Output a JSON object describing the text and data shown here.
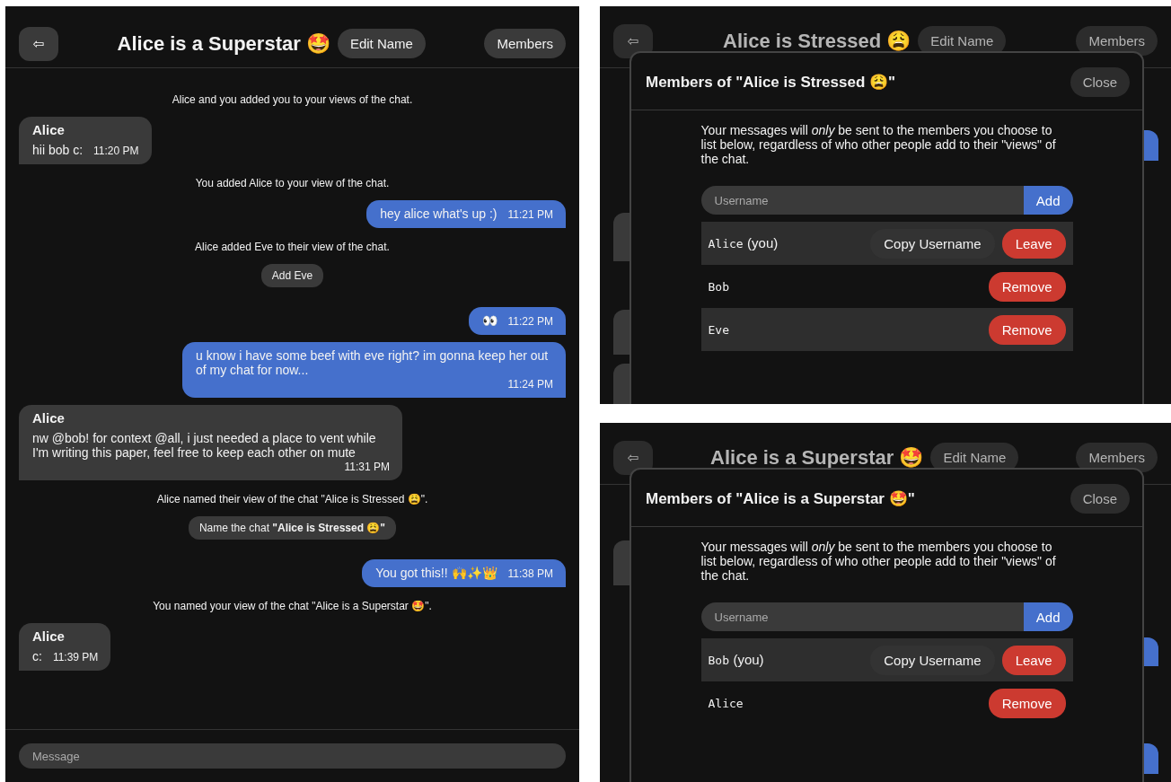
{
  "panels": [
    {
      "header": {
        "back_button": "⇦",
        "title": "Alice is a Superstar 🤩",
        "edit_button": "Edit Name",
        "members_button": "Members"
      },
      "messages": [
        {
          "kind": "system",
          "text": "Alice and you added you to your views of the chat."
        },
        {
          "kind": "incoming",
          "sender": "Alice",
          "text": "hii bob c:",
          "time": "11:20 PM"
        },
        {
          "kind": "system",
          "text": "You added Alice to your view of the chat."
        },
        {
          "kind": "outgoing",
          "text": "hey alice what's up :)",
          "time": "11:21 PM"
        },
        {
          "kind": "system",
          "text": "Alice added Eve to their view of the chat."
        },
        {
          "kind": "action",
          "text": "Add Eve"
        },
        {
          "kind": "outgoing",
          "text": "👀",
          "time": "11:22 PM"
        },
        {
          "kind": "outgoing",
          "text": "u know i have some beef with eve right? im gonna keep her out of my chat for now...",
          "time": "11:24 PM"
        },
        {
          "kind": "incoming",
          "sender": "Alice",
          "text": "nw @bob! for context @all, i just needed a place to vent while I'm writing this paper, feel free to keep each other on mute",
          "time": "11:31 PM"
        },
        {
          "kind": "system",
          "text": "Alice named their view of the chat \"Alice is Stressed 😩\"."
        },
        {
          "kind": "action",
          "text": "Name the chat **\"Alice is Stressed 😩\"**"
        },
        {
          "kind": "outgoing",
          "text": "You got this!! 🙌✨👑",
          "time": "11:38 PM"
        },
        {
          "kind": "system",
          "text": "You named your view of the chat \"Alice is a Superstar 🤩\"."
        },
        {
          "kind": "incoming",
          "sender": "Alice",
          "text": "c:",
          "time": "11:39 PM"
        }
      ],
      "composer": {
        "placeholder": "Message"
      }
    },
    {
      "header": {
        "back_button": "⇦",
        "title": "Alice is Stressed 😩",
        "edit_button": "Edit Name",
        "members_button": "Members"
      },
      "modal": {
        "title": "Members of \"Alice is Stressed 😩\"",
        "close_button": "Close",
        "notice": "Your messages will *only* be sent to the members you choose to list below, regardless of who other people add to their \"views\" of the chat.",
        "username_field": {
          "placeholder": "Username"
        },
        "add_button": "Add",
        "members": [
          {
            "name": "Alice",
            "you_label": "(you)",
            "buttons": [
              {
                "kind": "neutral",
                "label": "Copy Username"
              },
              {
                "kind": "danger",
                "label": "Leave"
              }
            ]
          },
          {
            "name": "Bob",
            "buttons": [
              {
                "kind": "danger",
                "label": "Remove"
              }
            ]
          },
          {
            "name": "Eve",
            "buttons": [
              {
                "kind": "danger",
                "label": "Remove"
              }
            ]
          }
        ]
      }
    },
    {
      "header": {
        "back_button": "⇦",
        "title": "Alice is a Superstar 🤩",
        "edit_button": "Edit Name",
        "members_button": "Members"
      },
      "modal": {
        "title": "Members of \"Alice is a Superstar 🤩\"",
        "close_button": "Close",
        "notice": "Your messages will *only* be sent to the members you choose to list below, regardless of who other people add to their \"views\" of the chat.",
        "username_field": {
          "placeholder": "Username"
        },
        "add_button": "Add",
        "members": [
          {
            "name": "Bob",
            "you_label": "(you)",
            "buttons": [
              {
                "kind": "neutral",
                "label": "Copy Username"
              },
              {
                "kind": "danger",
                "label": "Leave"
              }
            ]
          },
          {
            "name": "Alice",
            "buttons": [
              {
                "kind": "danger",
                "label": "Remove"
              }
            ]
          }
        ]
      }
    }
  ]
}
